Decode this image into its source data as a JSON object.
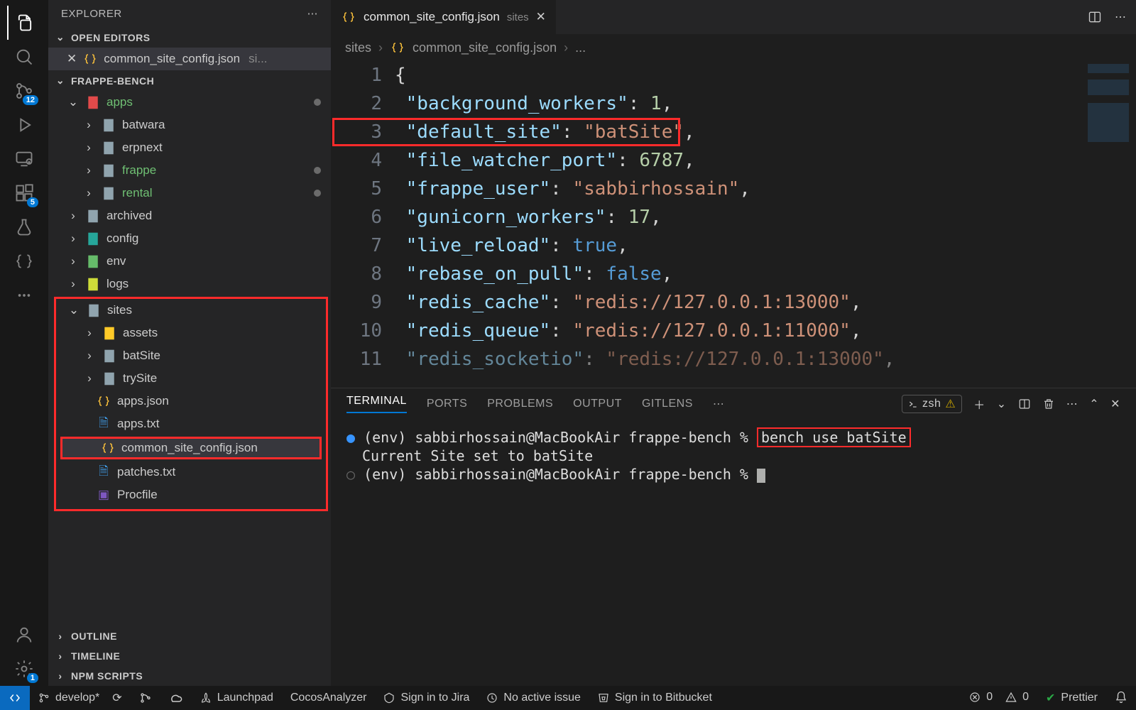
{
  "sidebar": {
    "title": "EXPLORER",
    "sections": {
      "open_editors": "OPEN EDITORS",
      "outline": "OUTLINE",
      "timeline": "TIMELINE",
      "npm": "NPM SCRIPTS"
    },
    "open_editor_item": {
      "name": "common_site_config.json",
      "hint": "si..."
    },
    "workspace": "FRAPPE-BENCH",
    "tree": {
      "apps": "apps",
      "batwara": "batwara",
      "erpnext": "erpnext",
      "frappe": "frappe",
      "rental": "rental",
      "archived": "archived",
      "config": "config",
      "env": "env",
      "logs": "logs",
      "sites": "sites",
      "assets": "assets",
      "batSite": "batSite",
      "trySite": "trySite",
      "apps_json": "apps.json",
      "apps_txt": "apps.txt",
      "common_site_config": "common_site_config.json",
      "patches_txt": "patches.txt",
      "procfile": "Procfile"
    }
  },
  "activity_badges": {
    "scm": "12",
    "ext": "5",
    "settings": "1"
  },
  "tab": {
    "filename": "common_site_config.json",
    "dir": "sites"
  },
  "breadcrumb": {
    "root": "sites",
    "file": "common_site_config.json",
    "more": "..."
  },
  "editor": {
    "lines": [
      "1",
      "2",
      "3",
      "4",
      "5",
      "6",
      "7",
      "8",
      "9",
      "10",
      "11"
    ],
    "l1": "{",
    "l2k": "\"background_workers\"",
    "l2v": "1",
    "l3k": "\"default_site\"",
    "l3v": "\"batSite\"",
    "l4k": "\"file_watcher_port\"",
    "l4v": "6787",
    "l5k": "\"frappe_user\"",
    "l5v": "\"sabbirhossain\"",
    "l6k": "\"gunicorn_workers\"",
    "l6v": "17",
    "l7k": "\"live_reload\"",
    "l7v": "true",
    "l8k": "\"rebase_on_pull\"",
    "l8v": "false",
    "l9k": "\"redis_cache\"",
    "l9v": "\"redis://127.0.0.1:13000\"",
    "l10k": "\"redis_queue\"",
    "l10v": "\"redis://127.0.0.1:11000\"",
    "l11k": "\"redis_socketio\"",
    "l11v": "\"redis://127.0.0.1:13000\""
  },
  "panel": {
    "tabs": {
      "terminal": "TERMINAL",
      "ports": "PORTS",
      "problems": "PROBLEMS",
      "output": "OUTPUT",
      "gitlens": "GITLENS"
    },
    "shell": "zsh",
    "prompt1": "(env) sabbirhossain@MacBookAir frappe-bench % ",
    "cmd1": "bench use batSite",
    "out1": "Current Site set to batSite",
    "prompt2": "(env) sabbirhossain@MacBookAir frappe-bench % "
  },
  "status": {
    "branch": "develop*",
    "launchpad": "Launchpad",
    "cocos": "CocosAnalyzer",
    "jira": "Sign in to Jira",
    "issue": "No active issue",
    "bitbucket": "Sign in to Bitbucket",
    "err": "0",
    "warn": "0",
    "prettier": "Prettier"
  }
}
